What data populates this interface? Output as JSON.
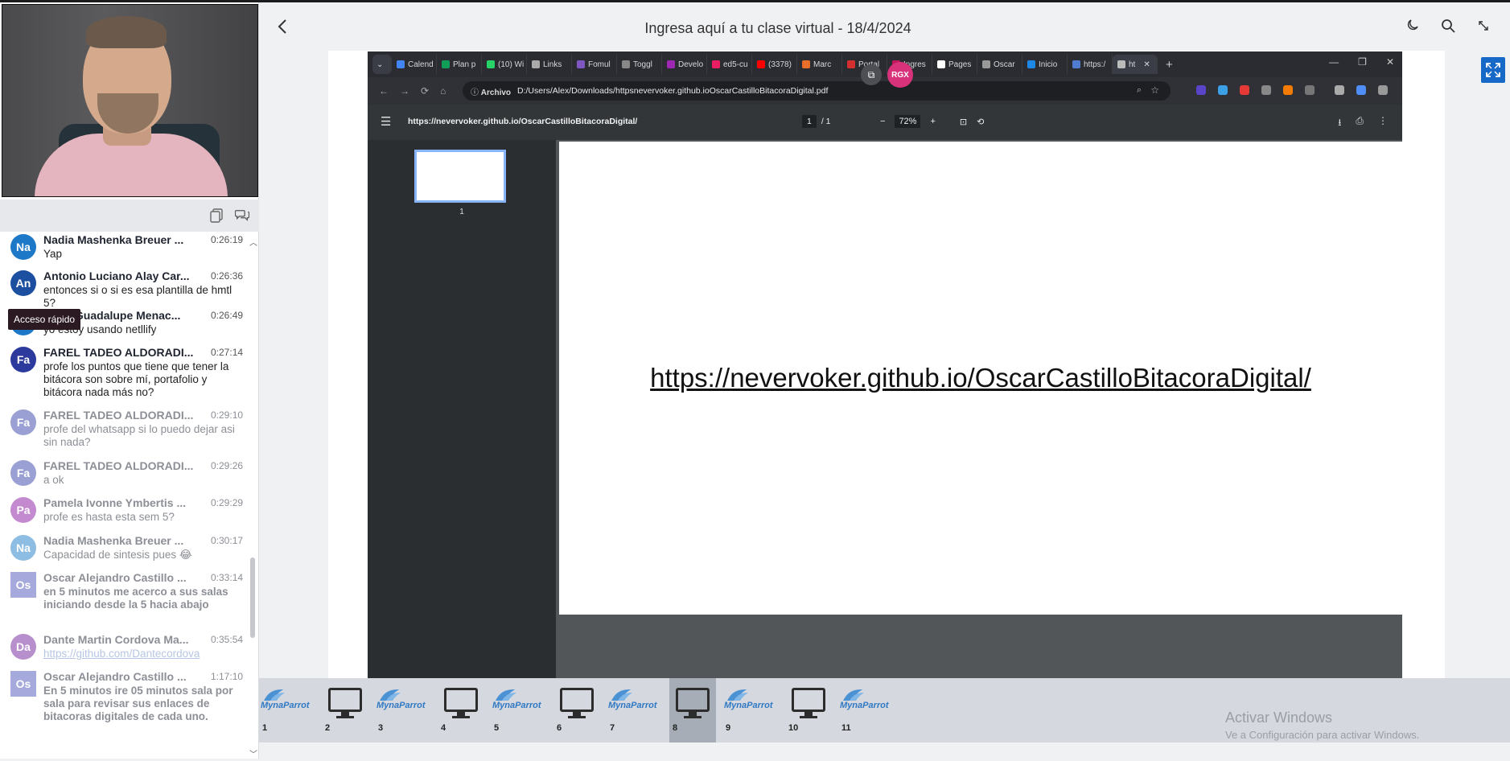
{
  "page_title": "Ingresa aquí a tu clase virtual - 18/4/2024",
  "tooltip": "Acceso rápido",
  "chat": [
    {
      "initials": "Na",
      "name": "Nadia Mashenka Breuer ...",
      "time": "0:26:19",
      "text": "Yap",
      "color": "#1e78c8",
      "dim": false
    },
    {
      "initials": "An",
      "name": "Antonio Luciano Alay Car...",
      "time": "0:26:36",
      "text": "entonces si o si es esa plantilla de hmtl 5?",
      "color": "#1d4fa0",
      "dim": false
    },
    {
      "initials": "",
      "name": "Kiara Guadalupe Menac...",
      "time": "0:26:49",
      "text": "yo estoy usando netllify",
      "color": "#1e78c8",
      "dim": false
    },
    {
      "initials": "Fa",
      "name": "FAREL TADEO ALDORADI...",
      "time": "0:27:14",
      "text": "profe los puntos que tiene que tener la bitácora son sobre mí, portafolio y bitácora nada más no?",
      "color": "#2b3a9c",
      "dim": false
    },
    {
      "initials": "Fa",
      "name": "FAREL TADEO ALDORADI...",
      "time": "0:29:10",
      "text": "profe del whatsapp si lo puedo dejar asi sin nada?",
      "color": "#9aa0d3",
      "dim": true
    },
    {
      "initials": "Fa",
      "name": "FAREL TADEO ALDORADI...",
      "time": "0:29:26",
      "text": "a ok",
      "color": "#9aa0d3",
      "dim": true
    },
    {
      "initials": "Pa",
      "name": "Pamela Ivonne Ymbertis ...",
      "time": "0:29:29",
      "text": "profe es hasta esta sem 5?",
      "color": "#c48ad0",
      "dim": true
    },
    {
      "initials": "Na",
      "name": "Nadia Mashenka Breuer ...",
      "time": "0:30:17",
      "text": "Capacidad de sintesis pues 😂",
      "color": "#8dbde3",
      "dim": true
    },
    {
      "initials": "Os",
      "name": "Oscar Alejandro Castillo ...",
      "time": "0:33:14",
      "text": "en 5 minutos me acerco a sus salas iniciando desde la 5 hacia abajo",
      "color": "#a5a9dc",
      "dim": true,
      "bold": true
    },
    {
      "initials": "Da",
      "name": "Dante Martin Cordova Ma...",
      "time": "0:35:54",
      "text": "https://github.com/Dantecordova",
      "color": "#b78fcc",
      "dim": true,
      "link": true
    },
    {
      "initials": "Os",
      "name": "Oscar Alejandro Castillo ...",
      "time": "1:17:10",
      "text": "En 5 minutos ire 05 minutos sala por sala para revisar sus enlaces de bitacoras digitales de cada uno.",
      "color": "#a5a9dc",
      "dim": true,
      "bold": true
    }
  ],
  "browser": {
    "tabs": [
      {
        "label": "Calend",
        "color": "#4285f4"
      },
      {
        "label": "Plan p",
        "color": "#0f9d58"
      },
      {
        "label": "(10) Wi",
        "color": "#25d366"
      },
      {
        "label": "Links",
        "color": "#aaaaaa"
      },
      {
        "label": "Fomul",
        "color": "#7e57c2"
      },
      {
        "label": "Toggl",
        "color": "#888888"
      },
      {
        "label": "Develo",
        "color": "#9c27b0"
      },
      {
        "label": "ed5-cu",
        "color": "#e91e63"
      },
      {
        "label": "(3378)",
        "color": "#ff0000"
      },
      {
        "label": "Marc",
        "color": "#e86e2c"
      },
      {
        "label": "Portal",
        "color": "#d32f2f"
      },
      {
        "label": "Ingres",
        "color": "#c2185b"
      },
      {
        "label": "Pages",
        "color": "#ffffff"
      },
      {
        "label": "Oscar",
        "color": "#999999"
      },
      {
        "label": "Inicio",
        "color": "#1e88e5"
      },
      {
        "label": "https:/",
        "color": "#4f7cd1"
      },
      {
        "label": "ht",
        "color": "#bbbbbb"
      }
    ],
    "overlay_badge": "RGX",
    "url_chip": "Archivo",
    "url": "D:/Users/Alex/Downloads/httpsnevervoker.github.ioOscarCastilloBitacoraDigital.pdf",
    "pdf_title": "https://nevervoker.github.io/OscarCastilloBitacoraDigital/",
    "page_current": "1",
    "page_total": "/  1",
    "zoom": "72%",
    "thumb_number": "1",
    "pdf_link": "https://nevervoker.github.io/OscarCastilloBitacoraDigital/"
  },
  "filmstrip": [
    {
      "num": "1",
      "type": "logo",
      "selected": false
    },
    {
      "num": "2",
      "type": "monitor",
      "selected": false
    },
    {
      "num": "3",
      "type": "logo",
      "selected": false
    },
    {
      "num": "4",
      "type": "monitor",
      "selected": false
    },
    {
      "num": "5",
      "type": "logo",
      "selected": false
    },
    {
      "num": "6",
      "type": "monitor",
      "selected": false
    },
    {
      "num": "7",
      "type": "logo",
      "selected": false
    },
    {
      "num": "8",
      "type": "monitor",
      "selected": true
    },
    {
      "num": "9",
      "type": "logo",
      "selected": false
    },
    {
      "num": "10",
      "type": "monitor",
      "selected": false
    },
    {
      "num": "11",
      "type": "logo",
      "selected": false
    }
  ],
  "logo_word": "MynaParrot",
  "watermark": {
    "line1": "Activar Windows",
    "line2": "Ve a Configuración para activar Windows."
  },
  "icons": {
    "back": "chevron-left-icon",
    "theme": "moon-icon",
    "search": "search-icon",
    "rotate": "rotate-icon",
    "fullscreen": "expand-icon"
  }
}
